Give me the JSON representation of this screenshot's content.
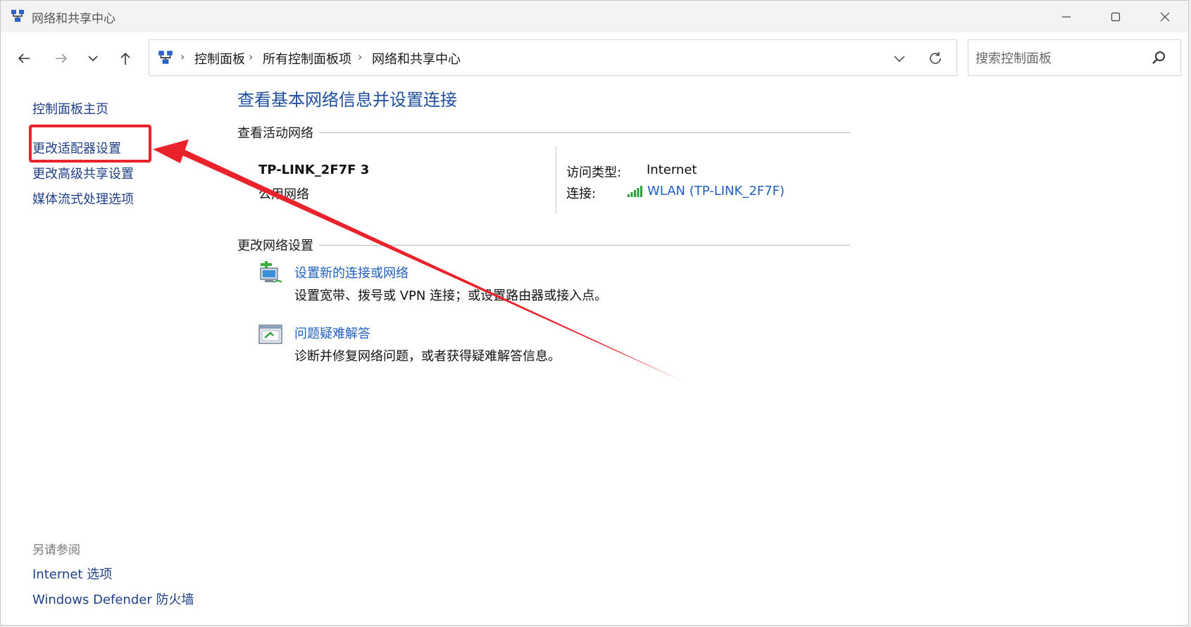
{
  "window": {
    "title": "网络和共享中心",
    "controls": {
      "minimize": "minimize-icon",
      "maximize": "maximize-icon",
      "close": "close-icon"
    }
  },
  "nav": {
    "icons": [
      "back-arrow-icon",
      "forward-arrow-icon",
      "chevron-down-icon",
      "up-arrow-icon"
    ],
    "breadcrumb": [
      "控制面板",
      "所有控制面板项",
      "网络和共享中心"
    ],
    "search_placeholder": "搜索控制面板"
  },
  "sidebar": {
    "links": [
      "控制面板主页",
      "更改适配器设置",
      "更改高级共享设置",
      "媒体流式处理选项"
    ],
    "see_also_title": "另请参阅",
    "see_also": [
      "Internet 选项",
      "Windows Defender 防火墙"
    ]
  },
  "main": {
    "title": "查看基本网络信息并设置连接",
    "active_networks": {
      "heading": "查看活动网络",
      "name": "TP-LINK_2F7F 3",
      "category": "公用网络",
      "access_label": "访问类型:",
      "access_value": "Internet",
      "connection_label": "连接:",
      "connection_value": "WLAN (TP-LINK_2F7F)"
    },
    "change_settings": {
      "heading": "更改网络设置",
      "tasks": [
        {
          "title": "设置新的连接或网络",
          "desc": "设置宽带、拨号或 VPN 连接；或设置路由器或接入点。",
          "icon": "new-connection-icon"
        },
        {
          "title": "问题疑难解答",
          "desc": "诊断并修复网络问题，或者获得疑难解答信息。",
          "icon": "troubleshoot-icon"
        }
      ]
    }
  },
  "colors": {
    "link": "#1f5fbf",
    "title": "#1f4e9e",
    "highlight": "#e8232b"
  }
}
